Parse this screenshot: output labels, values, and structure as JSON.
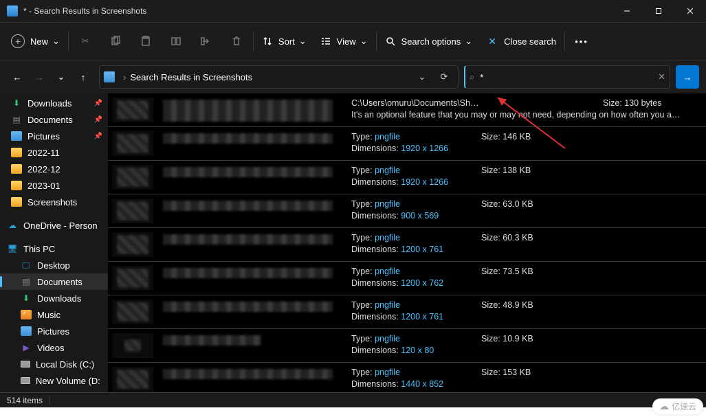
{
  "title": "* - Search Results in Screenshots",
  "toolbar": {
    "new": "New",
    "sort": "Sort",
    "view": "View",
    "search_options": "Search options",
    "close_search": "Close search"
  },
  "breadcrumb": "Search Results in Screenshots",
  "search_value": "*",
  "sidebar": {
    "downloads": "Downloads",
    "documents": "Documents",
    "pictures": "Pictures",
    "f2022_11": "2022-11",
    "f2022_12": "2022-12",
    "f2023_01": "2023-01",
    "screenshots": "Screenshots",
    "onedrive": "OneDrive - Person",
    "thispc": "This PC",
    "desktop": "Desktop",
    "documents2": "Documents",
    "downloads2": "Downloads",
    "music": "Music",
    "pictures2": "Pictures",
    "videos": "Videos",
    "localdisk": "Local Disk (C:)",
    "newvolume": "New Volume (D:"
  },
  "results": [
    {
      "path": "C:\\Users\\omuru\\Documents\\Sh…",
      "size": "Size: 130 bytes",
      "desc": "It's an optional feature that you may or may not need, depending on how often you are e…"
    },
    {
      "type_label": "Type:",
      "type_val": "pngfile",
      "dim_label": "Dimensions:",
      "dim_val": "1920 x 1266",
      "size": "Size: 146 KB"
    },
    {
      "type_label": "Type:",
      "type_val": "pngfile",
      "dim_label": "Dimensions:",
      "dim_val": "1920 x 1266",
      "size": "Size: 138 KB"
    },
    {
      "type_label": "Type:",
      "type_val": "pngfile",
      "dim_label": "Dimensions:",
      "dim_val": "900 x 569",
      "size": "Size: 63.0 KB"
    },
    {
      "type_label": "Type:",
      "type_val": "pngfile",
      "dim_label": "Dimensions:",
      "dim_val": "1200 x 761",
      "size": "Size: 60.3 KB"
    },
    {
      "type_label": "Type:",
      "type_val": "pngfile",
      "dim_label": "Dimensions:",
      "dim_val": "1200 x 762",
      "size": "Size: 73.5 KB"
    },
    {
      "type_label": "Type:",
      "type_val": "pngfile",
      "dim_label": "Dimensions:",
      "dim_val": "1200 x 761",
      "size": "Size: 48.9 KB"
    },
    {
      "type_label": "Type:",
      "type_val": "pngfile",
      "dim_label": "Dimensions:",
      "dim_val": "120 x 80",
      "size": "Size: 10.9 KB"
    },
    {
      "type_label": "Type:",
      "type_val": "pngfile",
      "dim_label": "Dimensions:",
      "dim_val": "1440 x 852",
      "size": "Size: 153 KB"
    }
  ],
  "status": {
    "count": "514 items"
  },
  "watermark": "亿速云"
}
